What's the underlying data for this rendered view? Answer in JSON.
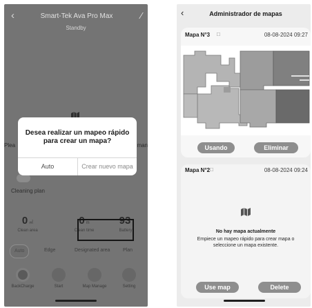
{
  "left_screen": {
    "device_title": "Smart-Tek Ava Pro Max",
    "status": "Standby",
    "side_left_text": "Plea",
    "side_right_text": "man",
    "cleaning_plan": "Cleaning plan",
    "stats": [
      {
        "value": "0",
        "unit": "㎡",
        "label": "Clean area"
      },
      {
        "value": "0",
        "unit": "m",
        "label": "Clean time"
      },
      {
        "value": "93",
        "unit": "",
        "label": "Battery"
      }
    ],
    "modes": [
      "Auto",
      "Edge",
      "Designated area",
      "Plan"
    ],
    "nav": [
      "BackCharge",
      "Start",
      "Map Manage",
      "Setting"
    ],
    "dialog": {
      "message": "Desea realizar un mapeo rápido para crear un mapa?",
      "cancel": "Auto",
      "confirm": "Crear nuevo mapa"
    }
  },
  "right_screen": {
    "title": "Administrador de mapas",
    "map1": {
      "name": "Mapa N°3",
      "date": "08-08-2024 09:27",
      "use_button": "Usando",
      "delete_button": "Eliminar"
    },
    "map2": {
      "name": "Mapa N°2",
      "date": "08-08-2024 09:24",
      "empty_title": "No hay mapa actualmente",
      "empty_text": "Empiece un mapeo rápido para crear mapa o seleccione un mapa existente.",
      "use_button": "Use map",
      "delete_button": "Delete"
    }
  },
  "icons": {
    "back": "chevron-left-icon",
    "edit": "pencil-icon",
    "map": "map-icon"
  },
  "colors": {
    "overlay_bg": "#747474",
    "dialog_bg": "#ffffff",
    "button_gray": "#8e8e8e",
    "panel_bg": "#ececec"
  }
}
